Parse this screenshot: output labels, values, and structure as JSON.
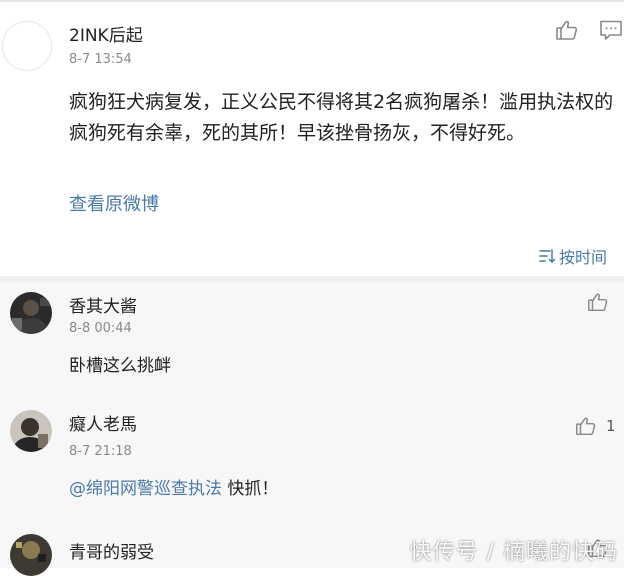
{
  "post": {
    "username": "2INK后起",
    "timestamp": "8-7 13:54",
    "text": "疯狗狂犬病复发，正义公民不得将其2名疯狗屠杀！滥用执法权的疯狗死有余辜，死的其所！早该挫骨扬灰，不得好死。",
    "view_original": "查看原微博",
    "sort_label": "按时间",
    "icons": [
      "thumbs-up-icon",
      "comment-icon",
      "sort-icon"
    ]
  },
  "comments": [
    {
      "username": "香其大酱",
      "timestamp": "8-8 00:44",
      "text": "卧槽这么挑衅",
      "likes": ""
    },
    {
      "username": "癡人老馬",
      "timestamp": "8-7 21:18",
      "mention": "@绵阳网警巡查执法",
      "text": " 快抓！",
      "likes": "1"
    },
    {
      "username": "青哥的弱受",
      "timestamp": "",
      "text": "",
      "likes": ""
    }
  ],
  "watermark": "快传号 / 楠曦的快码"
}
